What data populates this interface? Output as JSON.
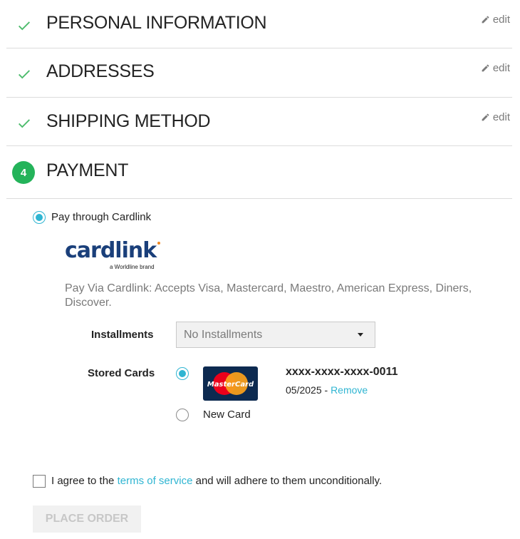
{
  "steps": [
    {
      "title": "PERSONAL INFORMATION",
      "edit": "edit"
    },
    {
      "title": "ADDRESSES",
      "edit": "edit"
    },
    {
      "title": "SHIPPING METHOD",
      "edit": "edit"
    },
    {
      "number": "4",
      "title": "PAYMENT"
    }
  ],
  "payment": {
    "option_label": "Pay through Cardlink",
    "logo_text": "cardlink",
    "logo_tagline": "a Worldline brand",
    "description": "Pay Via Cardlink: Accepts Visa, Mastercard, Maestro, American Express, Diners, Discover.",
    "installments_label": "Installments",
    "installments_value": "No Installments",
    "stored_cards_label": "Stored Cards",
    "card_number": "xxxx-xxxx-xxxx-0011",
    "card_expiry": "05/2025",
    "card_separator": " - ",
    "remove_label": "Remove",
    "card_brand": "MasterCard",
    "new_card_label": "New Card"
  },
  "terms": {
    "prefix": "I agree to the ",
    "link": "terms of service",
    "suffix": " and will adhere to them unconditionally."
  },
  "place_order_label": "PLACE ORDER",
  "colors": {
    "accent": "#2fb5d2",
    "success": "#24b35a",
    "mastercard_red": "#eb001b",
    "mastercard_yellow": "#f79e1b"
  }
}
